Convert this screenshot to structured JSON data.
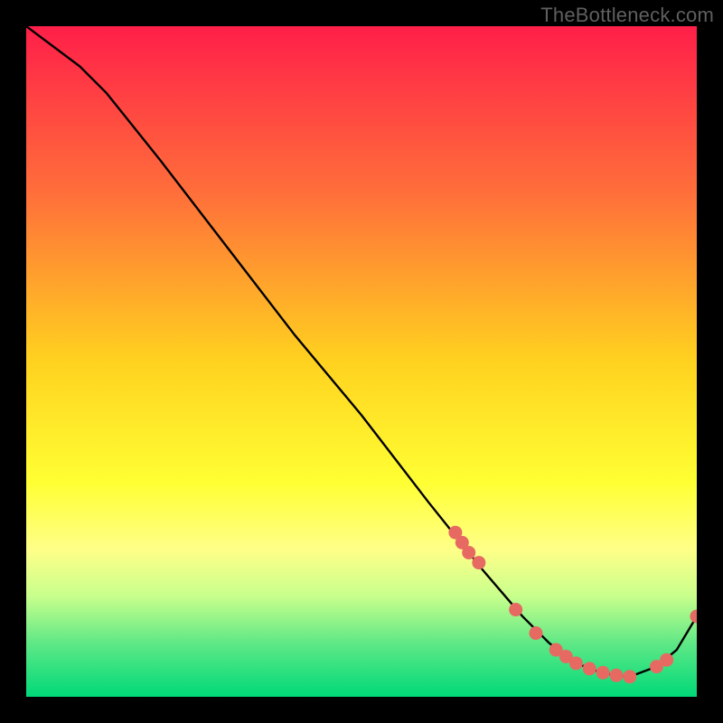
{
  "watermark": "TheBottleneck.com",
  "chart_data": {
    "type": "line",
    "title": "",
    "xlabel": "",
    "ylabel": "",
    "xlim": [
      0,
      100
    ],
    "ylim": [
      0,
      100
    ],
    "background_gradient": {
      "stops": [
        {
          "offset": 0,
          "color": "#ff1f49"
        },
        {
          "offset": 25,
          "color": "#ff6f3a"
        },
        {
          "offset": 50,
          "color": "#ffd21f"
        },
        {
          "offset": 68,
          "color": "#ffff33"
        },
        {
          "offset": 78,
          "color": "#ffff88"
        },
        {
          "offset": 85,
          "color": "#c8ff8c"
        },
        {
          "offset": 92,
          "color": "#5fe886"
        },
        {
          "offset": 100,
          "color": "#00d978"
        }
      ]
    },
    "series": [
      {
        "name": "curve",
        "color": "#000000",
        "x": [
          0,
          4,
          8,
          12,
          20,
          30,
          40,
          50,
          60,
          68,
          74,
          78,
          82,
          86,
          90,
          94,
          97,
          100
        ],
        "y": [
          100,
          97,
          94,
          90,
          80,
          67,
          54,
          42,
          29,
          19,
          12,
          8,
          5,
          3.5,
          3,
          4.5,
          7,
          12
        ]
      }
    ],
    "markers": [
      {
        "name": "highlight-points",
        "color": "#e66a62",
        "x": [
          64,
          65,
          66,
          67.5,
          73,
          76,
          79,
          80.5,
          82,
          84,
          86,
          88,
          90,
          94,
          95.5,
          100
        ],
        "y": [
          24.5,
          23,
          21.5,
          20,
          13,
          9.5,
          7,
          6,
          5,
          4.2,
          3.6,
          3.2,
          3,
          4.5,
          5.5,
          12
        ]
      }
    ]
  }
}
